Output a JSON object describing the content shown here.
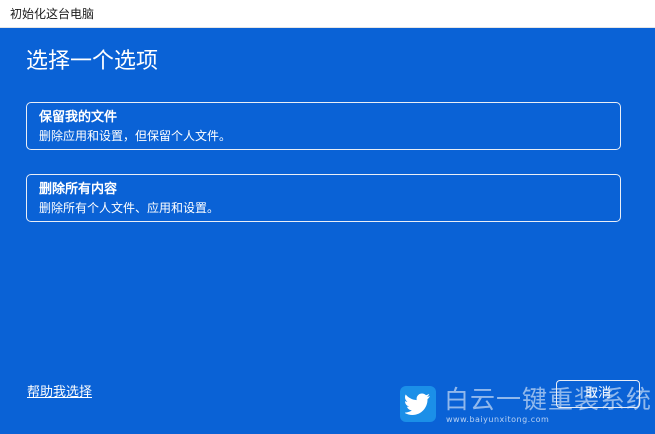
{
  "window": {
    "title": "初始化这台电脑"
  },
  "page": {
    "heading": "选择一个选项"
  },
  "options": [
    {
      "title": "保留我的文件",
      "description": "删除应用和设置，但保留个人文件。"
    },
    {
      "title": "删除所有内容",
      "description": "删除所有个人文件、应用和设置。"
    }
  ],
  "footer": {
    "help_link": "帮助我选择",
    "cancel_label": "取消"
  },
  "watermark": {
    "logo_icon": "bird-icon",
    "text": "白云一键重装系统",
    "url": "www.baiyunxitong.com"
  },
  "colors": {
    "background": "#0a62d6",
    "text": "#ffffff",
    "watermark_logo": "#1b8fe8"
  }
}
